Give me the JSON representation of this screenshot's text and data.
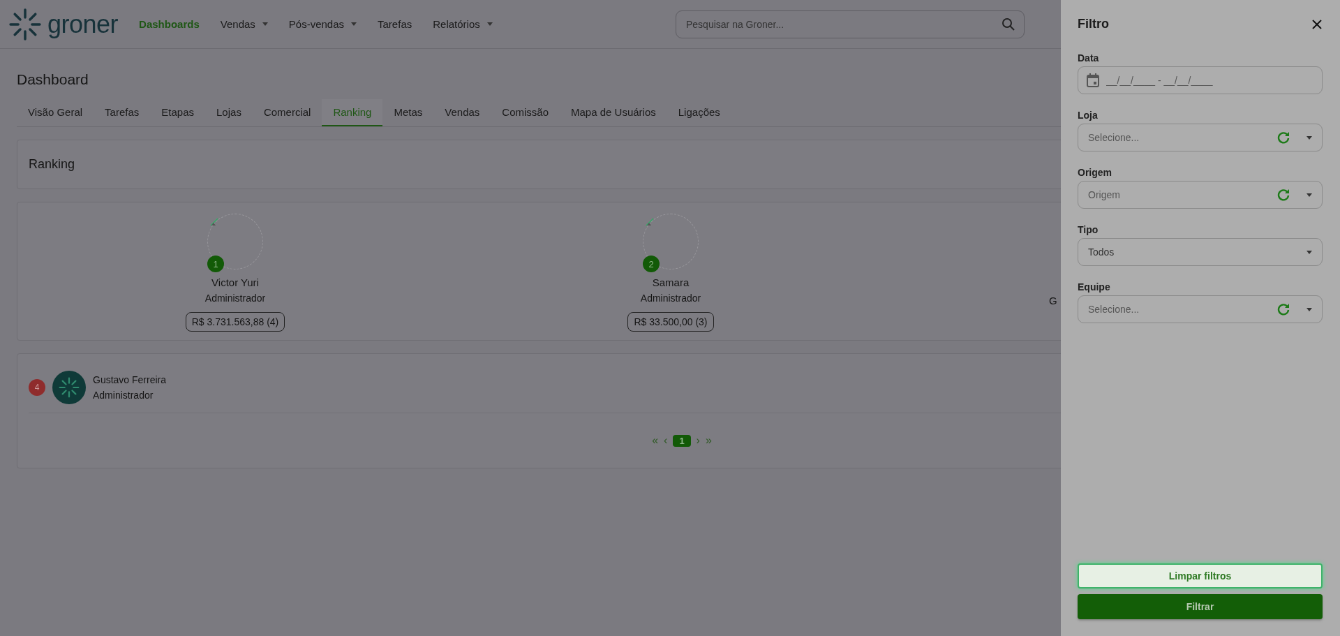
{
  "header": {
    "logo": "groner",
    "search": {
      "placeholder": "Pesquisar na Groner..."
    },
    "nav": [
      {
        "label": "Dashboards",
        "selected": true,
        "dropdown": false
      },
      {
        "label": "Vendas",
        "selected": false,
        "dropdown": true
      },
      {
        "label": "Pós-vendas",
        "selected": false,
        "dropdown": true
      },
      {
        "label": "Tarefas",
        "selected": false,
        "dropdown": false
      },
      {
        "label": "Relatórios",
        "selected": false,
        "dropdown": true
      }
    ]
  },
  "page": {
    "title": "Dashboard",
    "section_title": "Ranking",
    "tabs": [
      {
        "label": "Visão Geral",
        "selected": false
      },
      {
        "label": "Tarefas",
        "selected": false
      },
      {
        "label": "Etapas",
        "selected": false
      },
      {
        "label": "Lojas",
        "selected": false
      },
      {
        "label": "Comercial",
        "selected": false
      },
      {
        "label": "Ranking",
        "selected": true
      },
      {
        "label": "Metas",
        "selected": false
      },
      {
        "label": "Vendas",
        "selected": false
      },
      {
        "label": "Comissão",
        "selected": false
      },
      {
        "label": "Mapa de Usuários",
        "selected": false
      },
      {
        "label": "Ligações",
        "selected": false
      }
    ]
  },
  "podium": [
    {
      "kind": "full",
      "rank": "1",
      "name": "Victor Yuri",
      "role": "Administrador",
      "total": "R$ 3.731.563,88 (4)"
    },
    {
      "kind": "full",
      "rank": "2",
      "name": "Samara",
      "role": "Administrador",
      "total": "R$ 33.500,00 (3)"
    },
    {
      "kind": "cut",
      "name": "G"
    }
  ],
  "list": [
    {
      "rank": "4",
      "name": "Gustavo Ferreira",
      "role": "Administrador"
    }
  ],
  "pagination": {
    "first": "«",
    "prev": "‹",
    "next": "›",
    "last": "»",
    "pages": [
      {
        "label": "1",
        "selected": true
      }
    ]
  },
  "filter": {
    "title": "Filtro",
    "fields": [
      {
        "kind": "date",
        "label": "Data",
        "placeholder": "__/__/____ - __/__/____"
      },
      {
        "kind": "select",
        "label": "Loja",
        "placeholder": "Selecione...",
        "refresh": true
      },
      {
        "kind": "select",
        "label": "Origem",
        "placeholder": "Origem",
        "refresh": true
      },
      {
        "kind": "select",
        "label": "Tipo",
        "value": "Todos",
        "refresh": false
      },
      {
        "kind": "select",
        "label": "Equipe",
        "placeholder": "Selecione...",
        "refresh": true
      }
    ],
    "buttons": [
      {
        "kind": "secondary",
        "label": "Limpar filtros"
      },
      {
        "kind": "primary",
        "label": "Filtrar"
      }
    ]
  }
}
